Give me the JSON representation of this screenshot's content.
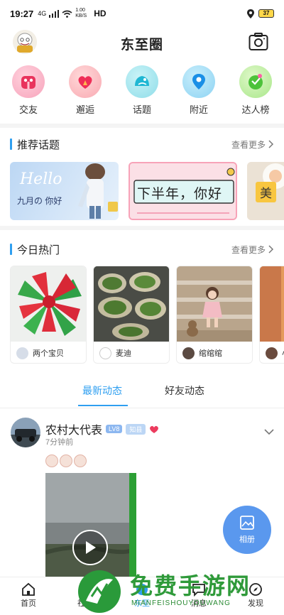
{
  "status": {
    "time": "19:27",
    "network": "4G",
    "speed": "1.00 KB/S",
    "hd": "HD",
    "battery": "37"
  },
  "header": {
    "title": "东至圈"
  },
  "quick": [
    {
      "label": "交友",
      "icon": "friends-icon"
    },
    {
      "label": "邂逅",
      "icon": "heart-icon"
    },
    {
      "label": "话题",
      "icon": "topic-icon"
    },
    {
      "label": "附近",
      "icon": "location-pin-icon"
    },
    {
      "label": "达人榜",
      "icon": "ranking-icon"
    }
  ],
  "topics": {
    "title": "推荐话题",
    "more": "查看更多",
    "cards": [
      {
        "line1": "Hello",
        "line2": "九月の 你好"
      },
      {
        "text": "下半年，你好"
      },
      {
        "text": "美"
      }
    ]
  },
  "hot": {
    "title": "今日热门",
    "more": "查看更多",
    "cards": [
      {
        "user": "两个宝贝"
      },
      {
        "user": "麦迪"
      },
      {
        "user": "绾绾绾"
      },
      {
        "user": "小"
      }
    ]
  },
  "feed": {
    "tabs": [
      "最新动态",
      "好友动态"
    ],
    "active": 0
  },
  "post": {
    "name": "农村大代表",
    "level": "LV8",
    "tag": "知县",
    "time": "7分钟前"
  },
  "fab": {
    "label": "相册"
  },
  "nav": {
    "items": [
      {
        "label": "首页",
        "icon": "home-icon"
      },
      {
        "label": "社区",
        "icon": "community-icon"
      },
      {
        "label": "东至",
        "icon": "circle-icon"
      },
      {
        "label": "消息",
        "icon": "message-icon"
      },
      {
        "label": "发现",
        "icon": "discover-icon"
      }
    ],
    "active": 2
  },
  "watermark": {
    "text": "免费手游网",
    "sub": "MIANFEISHOUYOUWANG"
  },
  "colors": {
    "accent": "#2f9ff0",
    "fab": "#5a98ee",
    "watermark": "#2f9a3a"
  }
}
